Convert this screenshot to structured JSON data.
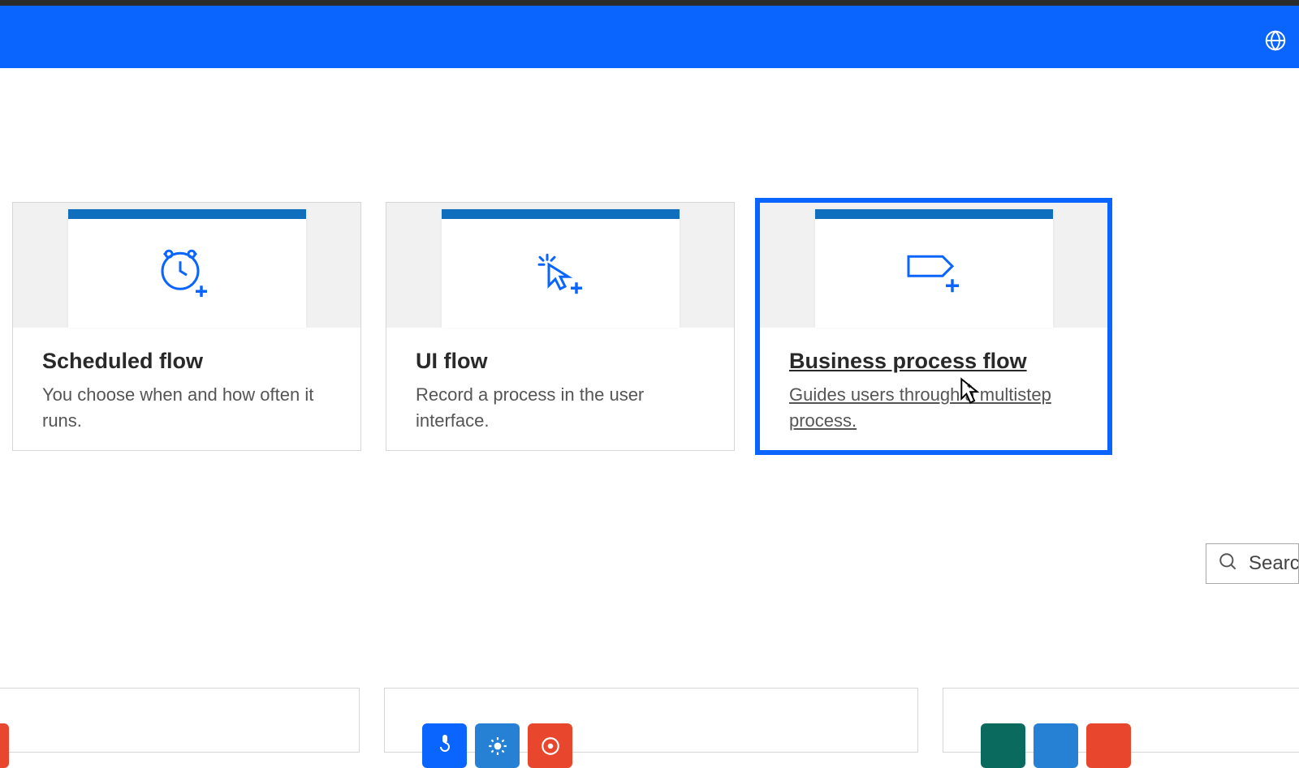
{
  "header": {
    "globe_icon": "globe-icon"
  },
  "cards": [
    {
      "id": "scheduled-flow",
      "title": "Scheduled flow",
      "description": "You choose when and how often it runs.",
      "icon": "clock-plus-icon",
      "selected": false
    },
    {
      "id": "ui-flow",
      "title": "UI flow",
      "description": "Record a process in the user interface.",
      "icon": "cursor-click-plus-icon",
      "selected": false
    },
    {
      "id": "business-process-flow",
      "title": "Business process flow",
      "description": "Guides users through a multistep process.",
      "icon": "stage-plus-icon",
      "selected": true
    }
  ],
  "search": {
    "placeholder": "Searc"
  },
  "colors": {
    "accent": "#0a65ff",
    "tile_red": "#e8472e",
    "tile_blue": "#0a65ff",
    "tile_bluemid": "#2680d4",
    "tile_teal": "#0b6a5e"
  }
}
